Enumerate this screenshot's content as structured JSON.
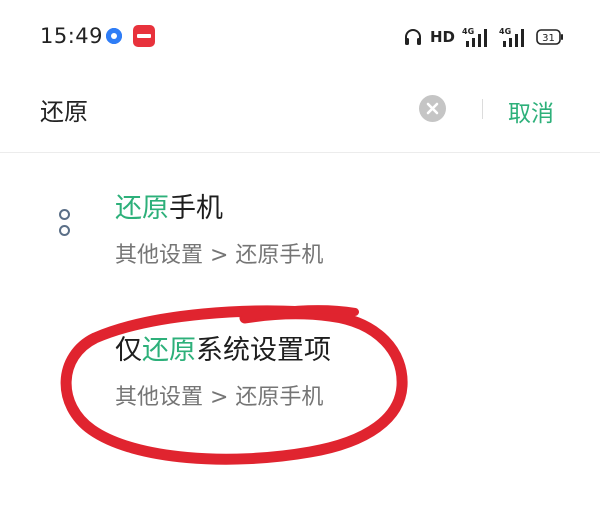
{
  "status_bar": {
    "time": "15:49",
    "network": "HD",
    "signal_1": "4G",
    "signal_2": "4G",
    "battery": "31",
    "icons": [
      "app-blue-icon",
      "app-red-icon",
      "headset-icon",
      "signal-icon",
      "battery-icon"
    ]
  },
  "search": {
    "query": "还原",
    "cancel_label": "取消"
  },
  "results": [
    {
      "title_before": "",
      "title_highlight": "还原",
      "title_after": "手机",
      "path": "其他设置 > 还原手机",
      "icon": "settings-icon"
    },
    {
      "title_before": "仅",
      "title_highlight": "还原",
      "title_after": "系统设置项",
      "path": "其他设置 > 还原手机",
      "icon": "settings-icon"
    }
  ],
  "colors": {
    "accent": "#2db07a",
    "annotation": "#e0242f",
    "secondary_text": "#757575"
  }
}
